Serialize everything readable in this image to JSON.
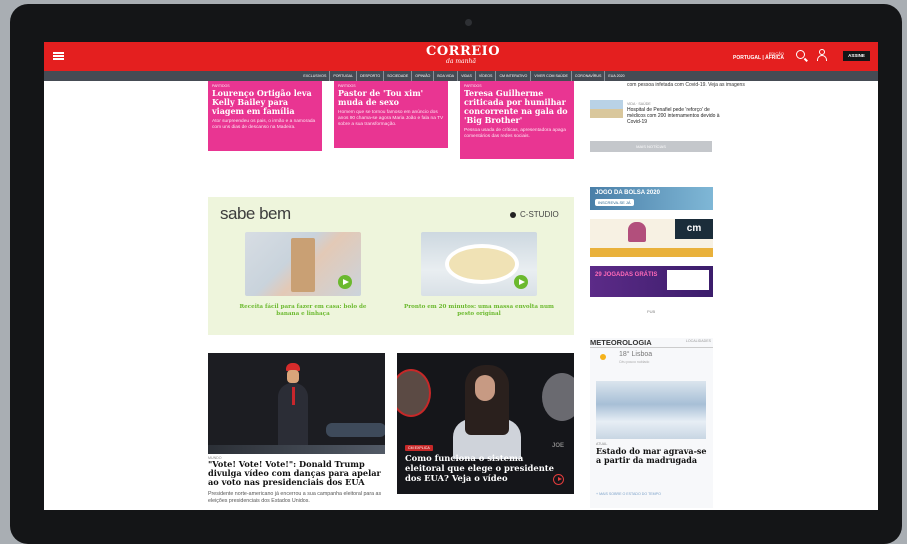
{
  "header": {
    "logo_main": "CORREIO",
    "logo_sub": "da manhã",
    "edition_label": "EDIÇÃO",
    "edition_value": "PORTUGAL | ÁFRICA",
    "subscribe_label": "ASSINE"
  },
  "nav": {
    "items": [
      "EXCLUSIVOS",
      "PORTUGAL",
      "DESPORTO",
      "SOCIEDADE",
      "OPINIÃO",
      "BOA VIDA",
      "VIDAS",
      "VÍDEOS",
      "CM INTERATIVO",
      "VIVER COM SAÚDE",
      "CORONAVÍRUS",
      "EUA 2020"
    ]
  },
  "pink_cards": [
    {
      "kicker": "PARTIDOS",
      "title": "Lourenço Ortigão leva Kelly Bailey para viagem em família",
      "lead": "Ator surpreendeu os pais, o irmão e a namorada com uns dias de descanso na Madeira."
    },
    {
      "kicker": "PARTIDOS",
      "title": "Pastor de 'Tou xim' muda de sexo",
      "lead": "Homem que se tornou famoso em anúncio dos anos 90 chama-se agora Maria João e fala na TV sobre a sua transformação."
    },
    {
      "kicker": "PARTIDOS",
      "title": "Teresa Guilherme criticada por humilhar concorrente na gala do 'Big Brother'",
      "lead": "Pessoa usada de críticas, apresentadora apaga comentários das redes sociais."
    }
  ],
  "sidebar_top": {
    "text": "com pessoa infetada com Covid-19. Veja as imagens",
    "item_kicker": "VIDA · SAÚDE",
    "item_text": "Hospital de Penafiel pede 'reforço' de médicos com 200 internamentos devido à Covid-19",
    "more_label": "MAIS NOTÍCIAS"
  },
  "sabe_bem": {
    "logo": "sabe bem",
    "studio": "C-STUDIO",
    "recipes": [
      {
        "caption": "Receita fácil para fazer em casa: bolo de banana e linhaça"
      },
      {
        "caption": "Pronto em 20 minutos: uma massa envolta num pesto original"
      }
    ]
  },
  "ads": {
    "ad1_title": "JOGO DA BOLSA 2020",
    "ad1_cta": "INSCREVA-SE JÁ",
    "ad2_logo": "cm",
    "ad3_title": "29 JOGADAS GRÁTIS",
    "tag": "PUB"
  },
  "meteo": {
    "title": "METEOROLOGIA",
    "link": "LOCALIDADES",
    "temp": "18° Lisboa",
    "temp_sub": "Céu pouco nublado",
    "kicker": "ATUAL",
    "headline": "Estado do mar agrava-se a partir da madrugada",
    "more": "+ MAIS SOBRE O ESTADO DO TEMPO"
  },
  "news": {
    "trump": {
      "kicker": "MUNDO",
      "title": "\"Vote! Vote! Vote!\": Donald Trump divulga vídeo com danças para apelar ao voto nas presidenciais dos EUA",
      "lead": "Presidente norte-americano já encerrou a sua campanha eleitoral para as eleições presidenciais dos Estados Unidos."
    },
    "video": {
      "badge": "CM EXPLICA",
      "title": "Como funciona o sistema eleitoral que elege o presidente dos EUA? Veja o vídeo",
      "overlay_text": "JOE"
    }
  }
}
